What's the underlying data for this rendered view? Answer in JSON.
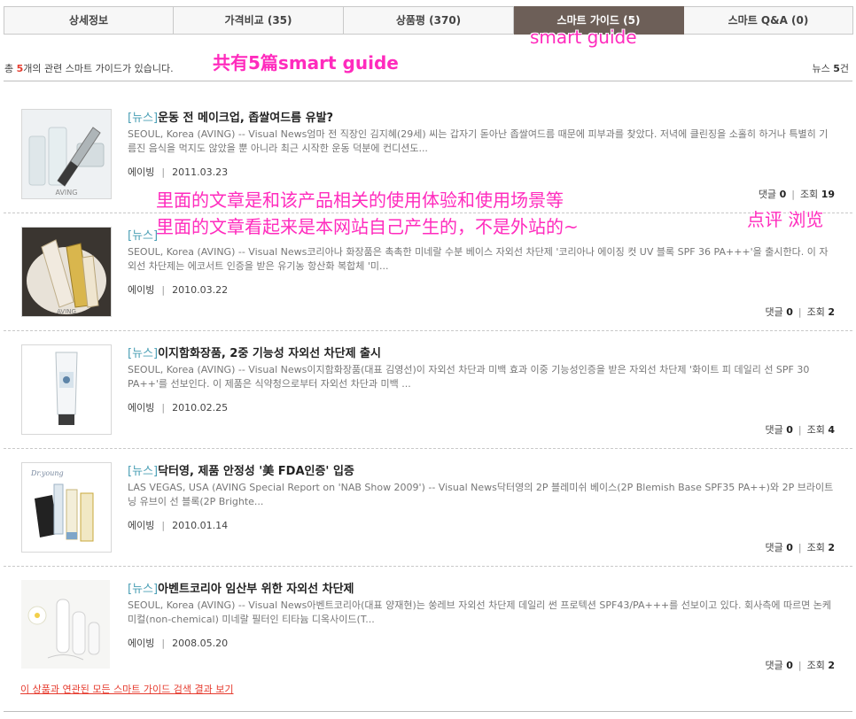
{
  "tabs": [
    {
      "label": "상세정보",
      "count": ""
    },
    {
      "label": "가격비교",
      "count": " (35)"
    },
    {
      "label": "상품평",
      "count": " (370)"
    },
    {
      "label": "스마트 가이드",
      "count": " (5)"
    },
    {
      "label": "스마트 Q&A",
      "count": " (0)"
    }
  ],
  "summary": {
    "prefix": "총 ",
    "count": "5",
    "suffix": "개의 관련 스마트 가이드가 있습니다.",
    "right_prefix": "뉴스 ",
    "right_count": "5",
    "right_suffix": "건"
  },
  "annotations": {
    "tab_note": "smart guide",
    "count_note": "共有5篇smart guide",
    "article_note_1": "里面的文章是和该产品相关的使用体验和使用场景等",
    "article_note_2": "里面的文章看起来是本网站自己产生的，不是外站的~",
    "stats_note": "点评 浏览"
  },
  "items": [
    {
      "category": "[뉴스]",
      "title": "운동 전 메이크업, 좁쌀여드름 유발?",
      "body": "SEOUL, Korea (AVING) -- Visual News엄마 전 직장인 김지혜(29세) 씨는 갑자기 돋아난 좁쌀여드름 때문에 피부과를 찾았다. 저녁에 클린징을 소홀히 하거나 특별히 기름진 음식을 먹지도 않았을 뿐 아니라 최근 시작한 운동 덕분에 컨디션도...",
      "source": "에이빙",
      "date": "2011.03.23",
      "comments_label": "댓글",
      "comments": "0",
      "views_label": "조회",
      "views": "19"
    },
    {
      "category": "[뉴스]",
      "title": "",
      "body": "SEOUL, Korea (AVING) -- Visual News코리아나 화장품은 촉촉한 미네랄 수분 베이스 자외선 차단제 '코리아나 에이징 컷 UV 블록 SPF 36 PA+++'을 출시한다. 이 자외선 차단제는 에코서트 인증을 받은 유기농 항산화 복합체 '미...",
      "source": "에이빙",
      "date": "2010.03.22",
      "comments_label": "댓글",
      "comments": "0",
      "views_label": "조회",
      "views": "2"
    },
    {
      "category": "[뉴스]",
      "title": "이지함화장품, 2중 기능성 자외선 차단제 출시",
      "body": "SEOUL, Korea (AVING) -- Visual News이지함화장품(대표 김영선)이 자외선 차단과 미백 효과 이중 기능성인증을 받은 자외선 차단제 '화이트 피 데일리 선 SPF 30 PA++'를 선보인다. 이 제품은 식약청으로부터 자외선 차단과 미백 ...",
      "source": "에이빙",
      "date": "2010.02.25",
      "comments_label": "댓글",
      "comments": "0",
      "views_label": "조회",
      "views": "4"
    },
    {
      "category": "[뉴스]",
      "title": "닥터영, 제품 안정성 '美 FDA인증' 입증",
      "body": "LAS VEGAS, USA (AVING Special Report on 'NAB Show 2009') -- Visual News닥터영의 2P 블레미쉬 베이스(2P Blemish Base SPF35 PA++)와 2P 브라이트닝 유브이 선 블록(2P Brighte...",
      "source": "에이빙",
      "date": "2010.01.14",
      "comments_label": "댓글",
      "comments": "0",
      "views_label": "조회",
      "views": "2"
    },
    {
      "category": "[뉴스]",
      "title": "아벤트코리아 임산부 위한 자외선 차단제",
      "body": "SEOUL, Korea (AVING) -- Visual News아벤트코리아(대표 양재현)는 쑹레브 자외선 차단제 데일리 썬 프로텍션 SPF43/PA+++를 선보이고 있다. 회사측에 따르면 논케미컬(non-chemical) 미네랄 필터인 티타늄 디옥사이드(T...",
      "source": "에이빙",
      "date": "2008.05.20",
      "comments_label": "댓글",
      "comments": "0",
      "views_label": "조회",
      "views": "2"
    }
  ],
  "thumb_labels": {
    "t1": "AVING",
    "t2": "AVING",
    "t4": "Dr.young"
  },
  "footer_link": "이 상품과 연관된 모든 스마트 가이드 검색 결과 보기"
}
